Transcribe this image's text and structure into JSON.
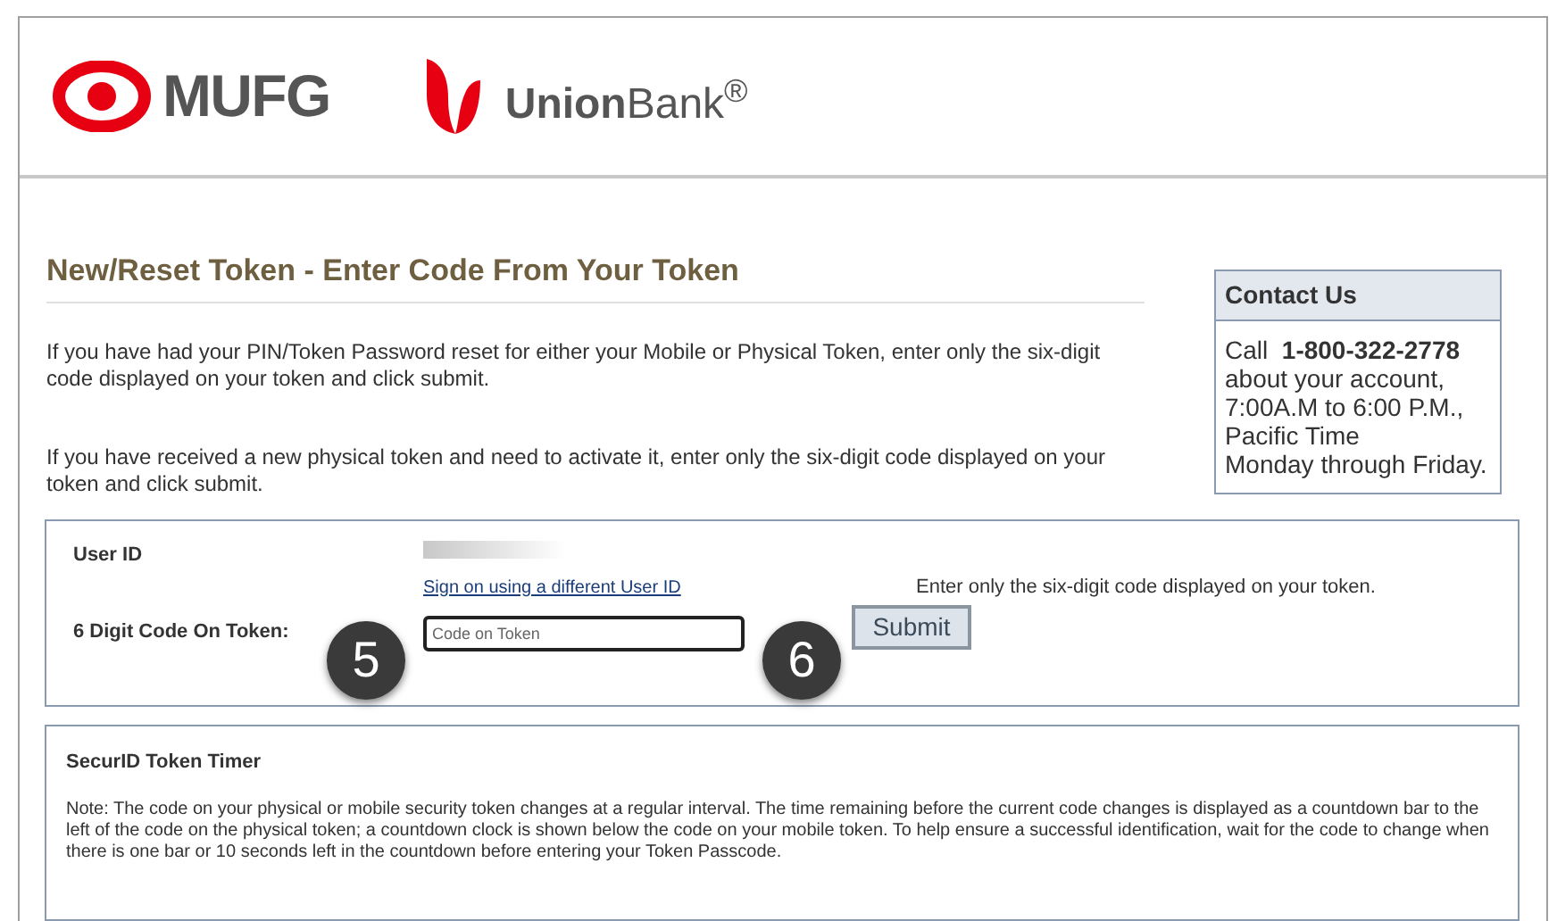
{
  "header": {
    "logos": [
      {
        "kind": "mufg",
        "text": "MUFG"
      },
      {
        "kind": "unionbank",
        "text": "**Union**Bank$^{®}$"
      }
    ]
  },
  "page": {
    "title": "New/Reset Token - Enter Code From Your Token",
    "paragraphs": [
      "If you have had your PIN/Token Password reset for either your Mobile or Physical Token, enter only the six-digit code displayed on your token and click submit.",
      "If you have received a new physical token and need to activate it, enter only the six-digit code displayed on your token and click submit."
    ]
  },
  "contact": {
    "title": "Contact Us",
    "lines": [
      "Call  **1-800-322-2778**",
      "about your account,",
      "7:00A.M to 6:00 P.M.,",
      "Pacific Time",
      "Monday through Friday."
    ]
  },
  "form": {
    "user_id_label": "User ID",
    "user_id_redacted": true,
    "switch_user_link": "Sign on using a different User ID",
    "code_label": "6 Digit Code On Token:",
    "code_field": {
      "placeholder": "Code on Token"
    },
    "hint": "Enter only the six-digit code displayed on your token.",
    "submit": "Submit",
    "step_markers": [
      {
        "label": "5"
      },
      {
        "label": "6"
      }
    ]
  },
  "timer": {
    "title": "SecurID Token Timer",
    "note": "Note: The code on your physical or mobile security token changes at a regular interval. The time remaining before the current code changes is displayed as a countdown bar to the left of the code on the physical token; a countdown clock is shown below the code on your mobile token. To help ensure a successful identification, wait for the code to change when there is one bar or 10 seconds left in the countdown before entering your Token Passcode."
  }
}
